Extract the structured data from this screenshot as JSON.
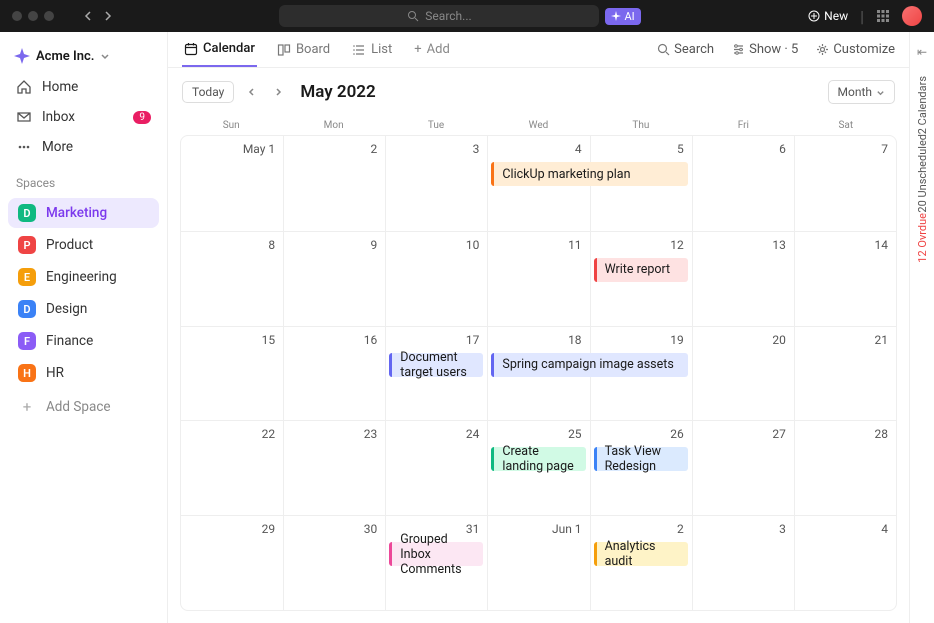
{
  "titlebar": {
    "search_placeholder": "Search...",
    "ai_label": "AI",
    "new_label": "New"
  },
  "workspace": {
    "name": "Acme Inc."
  },
  "nav": [
    {
      "icon": "home",
      "label": "Home"
    },
    {
      "icon": "inbox",
      "label": "Inbox",
      "badge": "9"
    },
    {
      "icon": "more",
      "label": "More"
    }
  ],
  "spaces_label": "Spaces",
  "spaces": [
    {
      "letter": "D",
      "name": "Marketing",
      "color": "#10b981",
      "active": true
    },
    {
      "letter": "P",
      "name": "Product",
      "color": "#ef4444"
    },
    {
      "letter": "E",
      "name": "Engineering",
      "color": "#f59e0b"
    },
    {
      "letter": "D",
      "name": "Design",
      "color": "#3b82f6"
    },
    {
      "letter": "F",
      "name": "Finance",
      "color": "#8b5cf6"
    },
    {
      "letter": "H",
      "name": "HR",
      "color": "#f97316"
    }
  ],
  "add_space_label": "Add Space",
  "views": [
    {
      "icon": "calendar",
      "label": "Calendar",
      "active": true
    },
    {
      "icon": "board",
      "label": "Board"
    },
    {
      "icon": "list",
      "label": "List"
    }
  ],
  "add_view_label": "Add",
  "toolbar_actions": {
    "search": "Search",
    "show": "Show · 5",
    "customize": "Customize"
  },
  "calendar": {
    "today_label": "Today",
    "month_title": "May 2022",
    "period_label": "Month",
    "dow": [
      "Sun",
      "Mon",
      "Tue",
      "Wed",
      "Thu",
      "Fri",
      "Sat"
    ],
    "weeks": [
      {
        "days": [
          "May 1",
          "2",
          "3",
          "4",
          "5",
          "6",
          "7"
        ],
        "events": [
          {
            "title": "ClickUp marketing plan",
            "start": 3,
            "span": 2,
            "color": "#f97316",
            "bg": "#ffedd5"
          }
        ]
      },
      {
        "days": [
          "8",
          "9",
          "10",
          "11",
          "12",
          "13",
          "14"
        ],
        "events": [
          {
            "title": "Write report",
            "start": 4,
            "span": 1,
            "color": "#ef4444",
            "bg": "#fee2e2"
          }
        ]
      },
      {
        "days": [
          "15",
          "16",
          "17",
          "18",
          "19",
          "20",
          "21"
        ],
        "events": [
          {
            "title": "Document target users",
            "start": 2,
            "span": 1,
            "color": "#6366f1",
            "bg": "#e0e7ff"
          },
          {
            "title": "Spring campaign image assets",
            "start": 3,
            "span": 2,
            "color": "#6366f1",
            "bg": "#e0e7ff"
          }
        ]
      },
      {
        "days": [
          "22",
          "23",
          "24",
          "25",
          "26",
          "27",
          "28"
        ],
        "events": [
          {
            "title": "Create landing page",
            "start": 3,
            "span": 1,
            "color": "#10b981",
            "bg": "#d1fae5"
          },
          {
            "title": "Task View Redesign",
            "start": 4,
            "span": 1,
            "color": "#3b82f6",
            "bg": "#dbeafe"
          }
        ]
      },
      {
        "days": [
          "29",
          "30",
          "31",
          "Jun 1",
          "2",
          "3",
          "4"
        ],
        "events": [
          {
            "title": "Grouped Inbox Comments",
            "start": 2,
            "span": 1,
            "color": "#ec4899",
            "bg": "#fce7f3"
          },
          {
            "title": "Analytics audit",
            "start": 4,
            "span": 1,
            "color": "#f59e0b",
            "bg": "#fef3c7"
          }
        ]
      }
    ]
  },
  "rail": [
    {
      "label": "2 Calendars",
      "color": "#555"
    },
    {
      "label": "20 Unscheduled",
      "color": "#555"
    },
    {
      "label": "12 Ovrdue",
      "color": "#ef4444"
    }
  ]
}
